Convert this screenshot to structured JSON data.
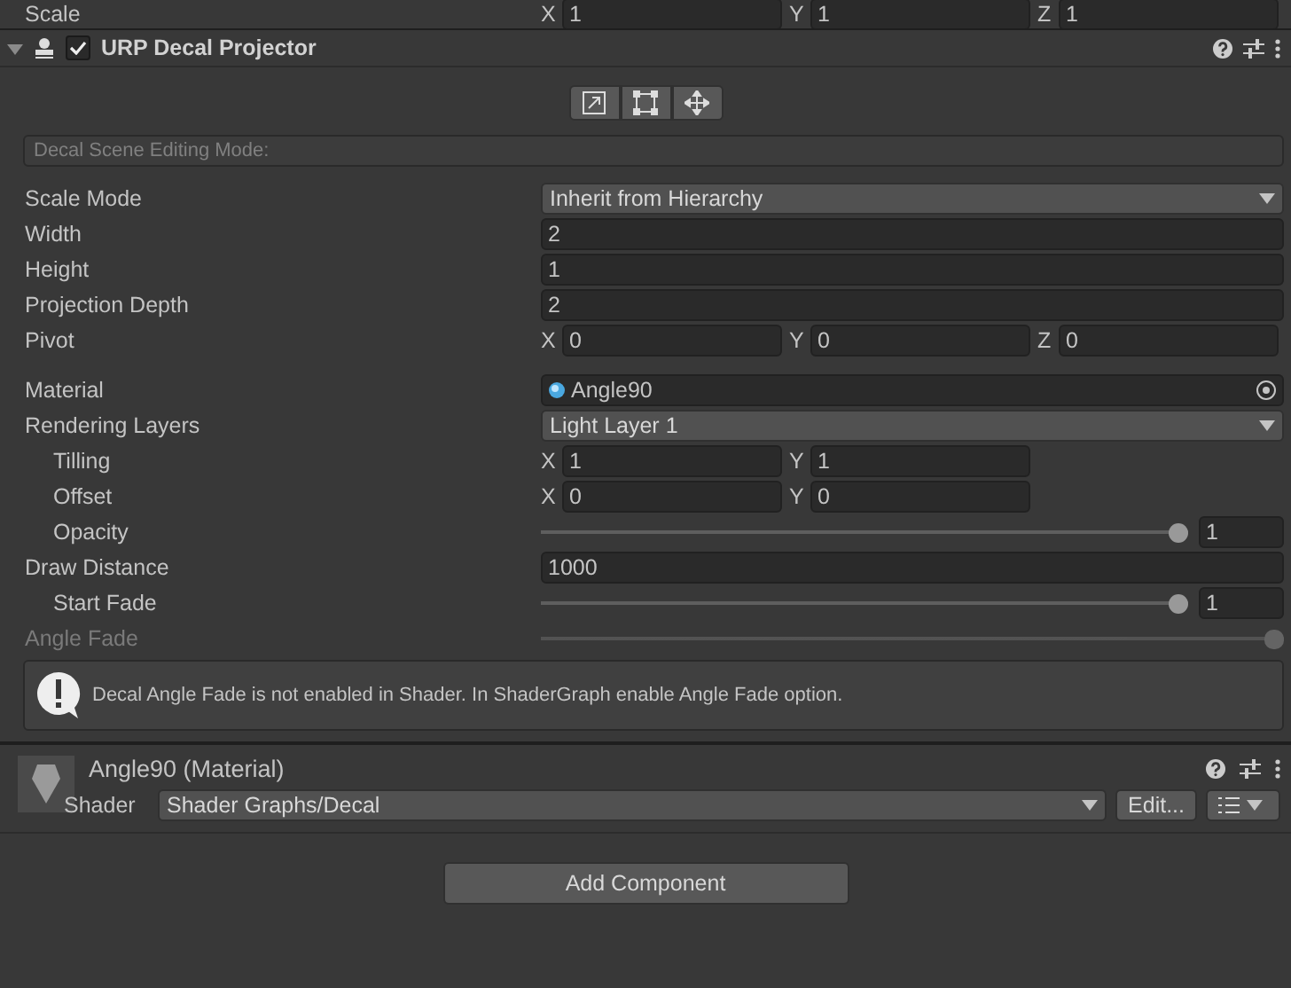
{
  "top_row": {
    "label": "Scale",
    "fields": [
      {
        "axis": "X",
        "value": "1"
      },
      {
        "axis": "Y",
        "value": "1"
      },
      {
        "axis": "Z",
        "value": "1"
      }
    ]
  },
  "component": {
    "title": "URP Decal Projector",
    "enabled": true,
    "expanded": true,
    "edit_modes": [
      {
        "selected": false
      },
      {
        "selected": false
      },
      {
        "selected": false
      }
    ],
    "scene_mode_label": "Decal Scene Editing Mode:",
    "properties": [
      {
        "kind": "dropdown",
        "label": "Scale Mode",
        "value": "Inherit from Hierarchy"
      },
      {
        "kind": "field",
        "label": "Width",
        "value": "2"
      },
      {
        "kind": "field",
        "label": "Height",
        "value": "1"
      },
      {
        "kind": "field",
        "label": "Projection Depth",
        "value": "2"
      },
      {
        "kind": "vector",
        "label": "Pivot",
        "fields": [
          {
            "axis": "X",
            "value": "0"
          },
          {
            "axis": "Y",
            "value": "0"
          },
          {
            "axis": "Z",
            "value": "0"
          }
        ]
      },
      {
        "kind": "object",
        "label": "Material",
        "value": "Angle90"
      },
      {
        "kind": "dropdown",
        "label": "Rendering Layers",
        "value": "Light Layer 1",
        "children": [
          {
            "kind": "vector",
            "label": "Tilling",
            "fields": [
              {
                "axis": "X",
                "value": "1"
              },
              {
                "axis": "Y",
                "value": "1"
              }
            ]
          },
          {
            "kind": "vector",
            "label": "Offset",
            "fields": [
              {
                "axis": "X",
                "value": "0"
              },
              {
                "axis": "Y",
                "value": "0"
              }
            ]
          },
          {
            "kind": "slider",
            "label": "Opacity",
            "level": 1,
            "value": "1"
          }
        ]
      },
      {
        "kind": "field",
        "label": "Draw Distance",
        "value": "1000",
        "children": [
          {
            "kind": "slider",
            "label": "Start Fade",
            "level": 1,
            "value": "1"
          }
        ]
      },
      {
        "kind": "range",
        "label": "Angle Fade",
        "level": 1,
        "disabled": true
      }
    ],
    "help": "Decal Angle Fade is not enabled in Shader. In ShaderGraph enable Angle Fade option."
  },
  "material": {
    "title": "Angle90 (Material)",
    "shader_label": "Shader",
    "shader": "Shader Graphs/Decal",
    "edit_button": "Edit..."
  },
  "add_component": "Add Component"
}
